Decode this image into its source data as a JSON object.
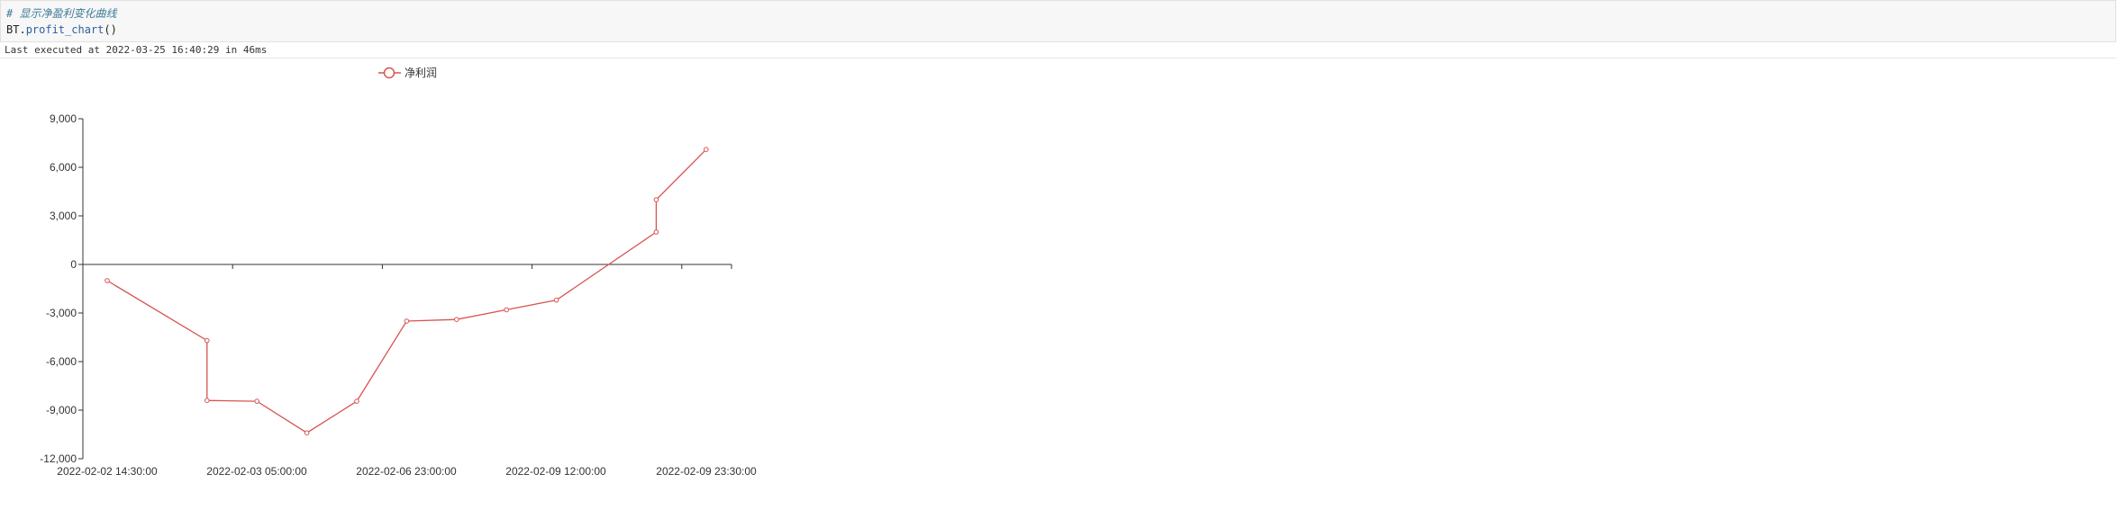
{
  "notebook": {
    "comment_line": "# 显示净盈利变化曲线",
    "code_object": "BT.",
    "code_function": "profit_chart",
    "code_parens": "()",
    "exec_status": "Last executed at 2022-03-25 16:40:29 in 46ms"
  },
  "colors": {
    "series": "#d9534f",
    "axis": "#333333"
  },
  "chart_data": {
    "type": "line",
    "legend_position": "top",
    "grid": false,
    "series": [
      {
        "name": "净利润",
        "values": [
          -1000,
          -4700,
          -8400,
          -8450,
          -10400,
          -8450,
          -3500,
          -3400,
          -2800,
          -2200,
          2000,
          4000,
          7100
        ]
      }
    ],
    "x_index": [
      0,
      2,
      2,
      3,
      4,
      5,
      6,
      7,
      8,
      9,
      11,
      11,
      12
    ],
    "x_tick_labels": [
      "2022-02-02 14:30:00",
      "2022-02-03 05:00:00",
      "2022-02-06 23:00:00",
      "2022-02-09 12:00:00",
      "2022-02-09 23:30:00"
    ],
    "y_ticks": [
      9000,
      6000,
      3000,
      0,
      -3000,
      -6000,
      -9000,
      -12000
    ],
    "y_tick_labels": [
      "9,000",
      "6,000",
      "3,000",
      "0",
      "-3,000",
      "-6,000",
      "-9,000",
      "-12,000"
    ],
    "ylim": [
      -12000,
      9000
    ]
  }
}
